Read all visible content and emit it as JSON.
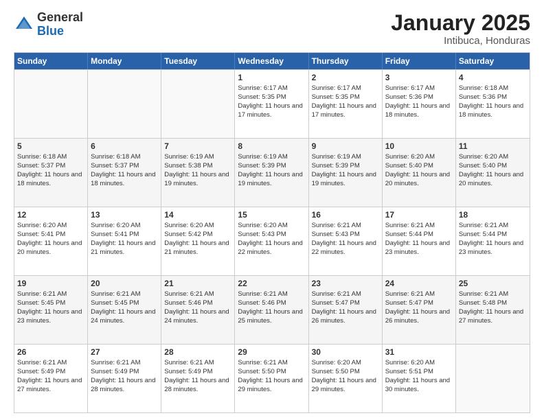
{
  "logo": {
    "general": "General",
    "blue": "Blue"
  },
  "header": {
    "title": "January 2025",
    "subtitle": "Intibuca, Honduras"
  },
  "days": [
    "Sunday",
    "Monday",
    "Tuesday",
    "Wednesday",
    "Thursday",
    "Friday",
    "Saturday"
  ],
  "weeks": [
    [
      {
        "day": "",
        "empty": true
      },
      {
        "day": "",
        "empty": true
      },
      {
        "day": "",
        "empty": true
      },
      {
        "day": "1",
        "sunrise": "6:17 AM",
        "sunset": "5:35 PM",
        "daylight": "11 hours and 17 minutes."
      },
      {
        "day": "2",
        "sunrise": "6:17 AM",
        "sunset": "5:35 PM",
        "daylight": "11 hours and 17 minutes."
      },
      {
        "day": "3",
        "sunrise": "6:17 AM",
        "sunset": "5:36 PM",
        "daylight": "11 hours and 18 minutes."
      },
      {
        "day": "4",
        "sunrise": "6:18 AM",
        "sunset": "5:36 PM",
        "daylight": "11 hours and 18 minutes."
      }
    ],
    [
      {
        "day": "5",
        "sunrise": "6:18 AM",
        "sunset": "5:37 PM",
        "daylight": "11 hours and 18 minutes."
      },
      {
        "day": "6",
        "sunrise": "6:18 AM",
        "sunset": "5:37 PM",
        "daylight": "11 hours and 18 minutes."
      },
      {
        "day": "7",
        "sunrise": "6:19 AM",
        "sunset": "5:38 PM",
        "daylight": "11 hours and 19 minutes."
      },
      {
        "day": "8",
        "sunrise": "6:19 AM",
        "sunset": "5:39 PM",
        "daylight": "11 hours and 19 minutes."
      },
      {
        "day": "9",
        "sunrise": "6:19 AM",
        "sunset": "5:39 PM",
        "daylight": "11 hours and 19 minutes."
      },
      {
        "day": "10",
        "sunrise": "6:20 AM",
        "sunset": "5:40 PM",
        "daylight": "11 hours and 20 minutes."
      },
      {
        "day": "11",
        "sunrise": "6:20 AM",
        "sunset": "5:40 PM",
        "daylight": "11 hours and 20 minutes."
      }
    ],
    [
      {
        "day": "12",
        "sunrise": "6:20 AM",
        "sunset": "5:41 PM",
        "daylight": "11 hours and 20 minutes."
      },
      {
        "day": "13",
        "sunrise": "6:20 AM",
        "sunset": "5:41 PM",
        "daylight": "11 hours and 21 minutes."
      },
      {
        "day": "14",
        "sunrise": "6:20 AM",
        "sunset": "5:42 PM",
        "daylight": "11 hours and 21 minutes."
      },
      {
        "day": "15",
        "sunrise": "6:20 AM",
        "sunset": "5:43 PM",
        "daylight": "11 hours and 22 minutes."
      },
      {
        "day": "16",
        "sunrise": "6:21 AM",
        "sunset": "5:43 PM",
        "daylight": "11 hours and 22 minutes."
      },
      {
        "day": "17",
        "sunrise": "6:21 AM",
        "sunset": "5:44 PM",
        "daylight": "11 hours and 23 minutes."
      },
      {
        "day": "18",
        "sunrise": "6:21 AM",
        "sunset": "5:44 PM",
        "daylight": "11 hours and 23 minutes."
      }
    ],
    [
      {
        "day": "19",
        "sunrise": "6:21 AM",
        "sunset": "5:45 PM",
        "daylight": "11 hours and 23 minutes."
      },
      {
        "day": "20",
        "sunrise": "6:21 AM",
        "sunset": "5:45 PM",
        "daylight": "11 hours and 24 minutes."
      },
      {
        "day": "21",
        "sunrise": "6:21 AM",
        "sunset": "5:46 PM",
        "daylight": "11 hours and 24 minutes."
      },
      {
        "day": "22",
        "sunrise": "6:21 AM",
        "sunset": "5:46 PM",
        "daylight": "11 hours and 25 minutes."
      },
      {
        "day": "23",
        "sunrise": "6:21 AM",
        "sunset": "5:47 PM",
        "daylight": "11 hours and 26 minutes."
      },
      {
        "day": "24",
        "sunrise": "6:21 AM",
        "sunset": "5:47 PM",
        "daylight": "11 hours and 26 minutes."
      },
      {
        "day": "25",
        "sunrise": "6:21 AM",
        "sunset": "5:48 PM",
        "daylight": "11 hours and 27 minutes."
      }
    ],
    [
      {
        "day": "26",
        "sunrise": "6:21 AM",
        "sunset": "5:49 PM",
        "daylight": "11 hours and 27 minutes."
      },
      {
        "day": "27",
        "sunrise": "6:21 AM",
        "sunset": "5:49 PM",
        "daylight": "11 hours and 28 minutes."
      },
      {
        "day": "28",
        "sunrise": "6:21 AM",
        "sunset": "5:49 PM",
        "daylight": "11 hours and 28 minutes."
      },
      {
        "day": "29",
        "sunrise": "6:21 AM",
        "sunset": "5:50 PM",
        "daylight": "11 hours and 29 minutes."
      },
      {
        "day": "30",
        "sunrise": "6:20 AM",
        "sunset": "5:50 PM",
        "daylight": "11 hours and 29 minutes."
      },
      {
        "day": "31",
        "sunrise": "6:20 AM",
        "sunset": "5:51 PM",
        "daylight": "11 hours and 30 minutes."
      },
      {
        "day": "",
        "empty": true
      }
    ]
  ]
}
